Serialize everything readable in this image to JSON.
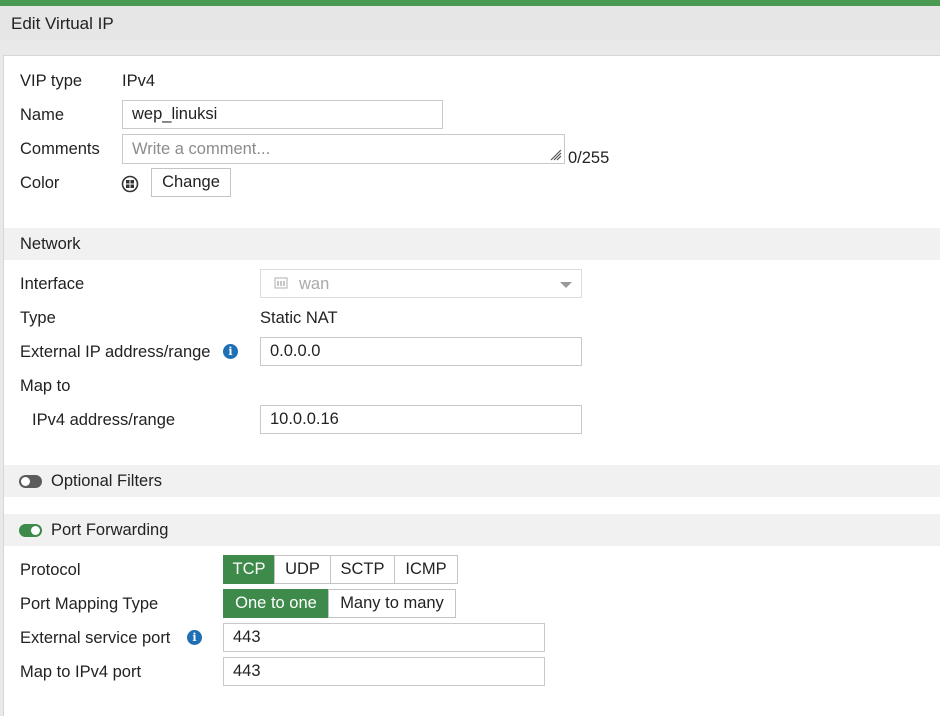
{
  "header": {
    "title": "Edit Virtual IP"
  },
  "general": {
    "vip_type_label": "VIP type",
    "vip_type_value": "IPv4",
    "name_label": "Name",
    "name_value": "wep_linuksi",
    "comments_label": "Comments",
    "comments_placeholder": "Write a comment...",
    "comments_counter": "0/255",
    "color_label": "Color",
    "color_change_button": "Change"
  },
  "network": {
    "section_title": "Network",
    "interface_label": "Interface",
    "interface_value": "wan",
    "type_label": "Type",
    "type_value": "Static NAT",
    "external_ip_label": "External IP address/range",
    "external_ip_value": "0.0.0.0",
    "map_to_label": "Map to",
    "ipv4_range_label": "IPv4 address/range",
    "ipv4_range_value": "10.0.0.16"
  },
  "optional_filters": {
    "label": "Optional Filters",
    "enabled": false
  },
  "port_forwarding": {
    "label": "Port Forwarding",
    "enabled": true,
    "protocol_label": "Protocol",
    "protocols": [
      "TCP",
      "UDP",
      "SCTP",
      "ICMP"
    ],
    "protocol_selected": "TCP",
    "mapping_type_label": "Port Mapping Type",
    "mapping_types": [
      "One to one",
      "Many to many"
    ],
    "mapping_selected": "One to one",
    "external_port_label": "External service port",
    "external_port_value": "443",
    "map_port_label": "Map to IPv4 port",
    "map_port_value": "443"
  },
  "colors": {
    "accent": "#3e8a4a",
    "top_bar": "#4b9a53",
    "info": "#1f6fb5"
  },
  "icons": [
    "color-icon",
    "info-icon",
    "interface-icon",
    "chevron-down-icon",
    "resize-grip-icon",
    "toggle-switch-icon"
  ]
}
